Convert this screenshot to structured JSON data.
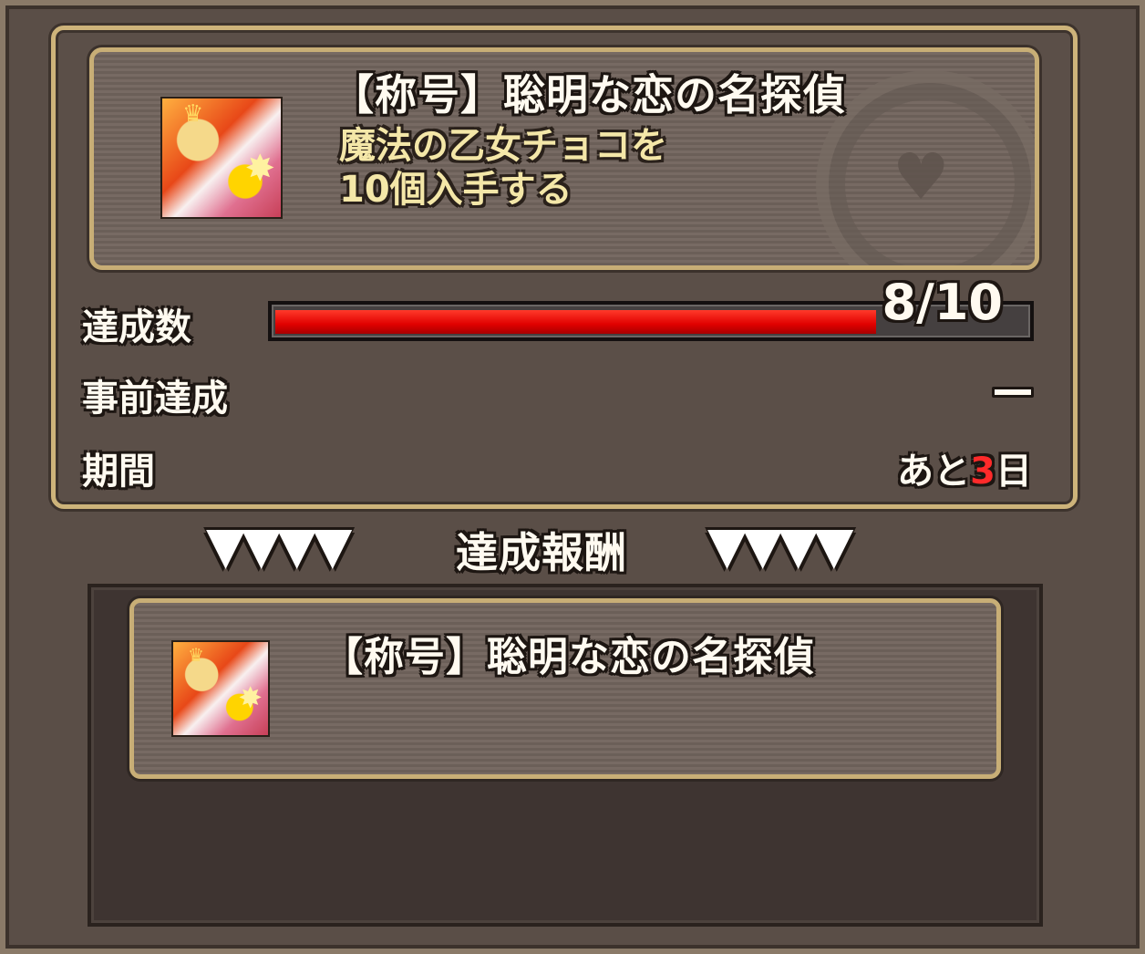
{
  "mission": {
    "title": "【称号】聡明な恋の名探偵",
    "description_line1": "魔法の乙女チョコを",
    "description_line2": "10個入手する"
  },
  "progress": {
    "label": "達成数",
    "current": 8,
    "total": 10,
    "display": "8/10",
    "fill_fraction": 0.8
  },
  "pre_achievement": {
    "label": "事前達成",
    "value": "―"
  },
  "period": {
    "label": "期間",
    "prefix": "あと",
    "days": "3",
    "suffix": "日"
  },
  "reward_header": {
    "arrows_left": "▼▼▼▼",
    "label": "達成報酬",
    "arrows_right": "▼▼▼▼"
  },
  "reward": {
    "title": "【称号】聡明な恋の名探偵"
  },
  "colors": {
    "progress_fill": "#e00000",
    "frame_gold": "#cdb37a",
    "description_text": "#f4e7a8",
    "days_highlight": "#ff2a2a"
  },
  "icons": {
    "mission_icon": "character-portrait-icon",
    "reward_icon": "character-portrait-icon"
  }
}
